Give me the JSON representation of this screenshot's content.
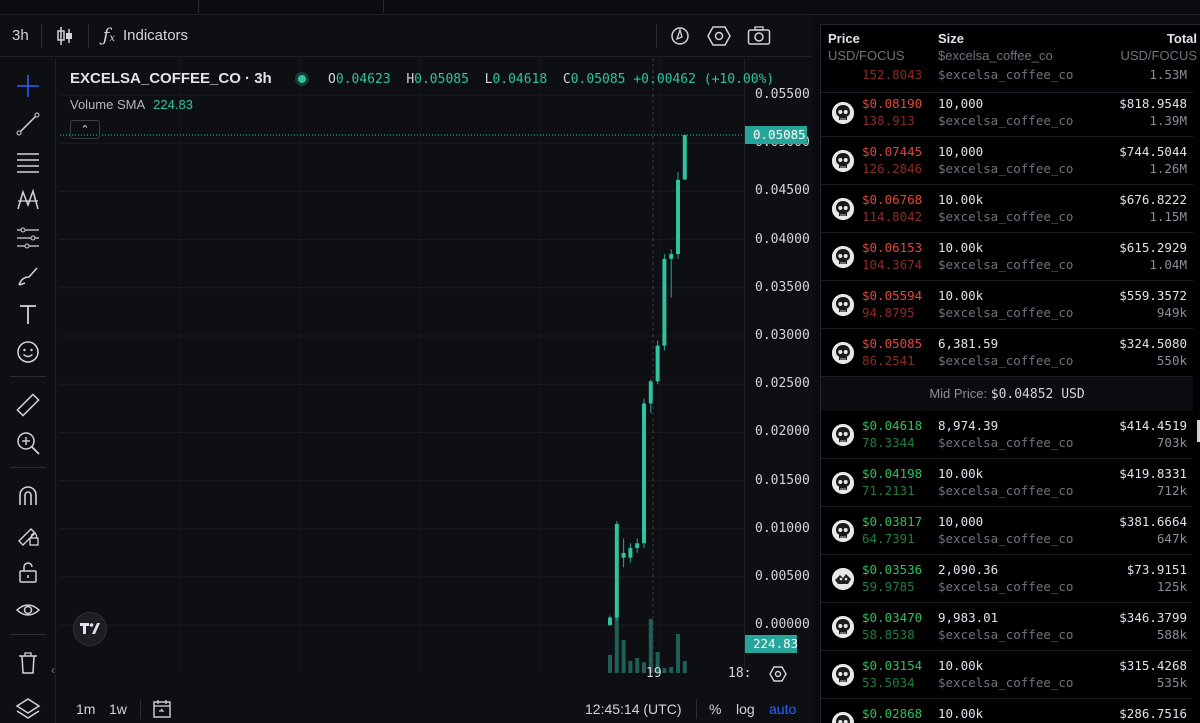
{
  "toolbar": {
    "interval": "3h",
    "indicators_label": "Indicators"
  },
  "legend": {
    "symbol": "EXCELSA_COFFEE_CO · 3h",
    "o_label": "O",
    "o": "0.04623",
    "h_label": "H",
    "h": "0.05085",
    "l_label": "L",
    "l": "0.04618",
    "c_label": "C",
    "c": "0.05085",
    "change": "+0.00462 (+10.00%)",
    "volume_label": "Volume SMA",
    "volume_value": "224.83"
  },
  "price_axis": {
    "ticks": [
      "0.05500",
      "0.05000",
      "0.04500",
      "0.04000",
      "0.03500",
      "0.03000",
      "0.02500",
      "0.02000",
      "0.01500",
      "0.01000",
      "0.00500",
      "0.00000"
    ],
    "last_price_badge": "0.05085",
    "volume_badge": "224.83"
  },
  "time_axis": {
    "labels": [
      "19",
      "18:"
    ]
  },
  "bottom_bar": {
    "range_1m": "1m",
    "range_1w": "1w",
    "clock": "12:45:14 (UTC)",
    "percent": "%",
    "log": "log",
    "auto": "auto"
  },
  "colors": {
    "up": "#26a69a",
    "up_bright": "#2ec4a0",
    "ask": "#e2453c",
    "bid": "#2fbf5e",
    "auto": "#2962ff"
  },
  "chart_data": {
    "type": "candlestick",
    "y_range": [
      -0.001,
      0.0565
    ],
    "candles": [
      {
        "o": 0.0,
        "h": 0.001,
        "l": 0.0,
        "c": 0.0008
      },
      {
        "o": 0.0008,
        "h": 0.0108,
        "l": 0.0005,
        "c": 0.0105
      },
      {
        "o": 0.0075,
        "h": 0.009,
        "l": 0.006,
        "c": 0.007
      },
      {
        "o": 0.007,
        "h": 0.0085,
        "l": 0.0065,
        "c": 0.008
      },
      {
        "o": 0.008,
        "h": 0.009,
        "l": 0.0075,
        "c": 0.0085
      },
      {
        "o": 0.0085,
        "h": 0.0235,
        "l": 0.008,
        "c": 0.023
      },
      {
        "o": 0.023,
        "h": 0.0255,
        "l": 0.022,
        "c": 0.0253
      },
      {
        "o": 0.0253,
        "h": 0.0295,
        "l": 0.025,
        "c": 0.029
      },
      {
        "o": 0.029,
        "h": 0.0385,
        "l": 0.0285,
        "c": 0.038
      },
      {
        "o": 0.038,
        "h": 0.039,
        "l": 0.034,
        "c": 0.0385
      },
      {
        "o": 0.0385,
        "h": 0.047,
        "l": 0.038,
        "c": 0.0462
      },
      {
        "o": 0.04623,
        "h": 0.05085,
        "l": 0.04618,
        "c": 0.05085
      }
    ],
    "volume": [
      0.3,
      1.0,
      0.55,
      0.2,
      0.25,
      0.18,
      0.9,
      0.35,
      0.08,
      0.1,
      0.65,
      0.2
    ]
  },
  "orderbook": {
    "headers": {
      "price": "Price",
      "price_sub": "USD/FOCUS",
      "size": "Size",
      "size_sub": "$excelsa_coffee_co",
      "total": "Total",
      "total_sub": "USD/FOCUS"
    },
    "partial_ask": {
      "price2": "152.8043",
      "size_sub": "$excelsa_coffee_co",
      "total_sub": "1.53M"
    },
    "asks": [
      {
        "price": "$0.08190",
        "price2": "138.913",
        "size": "10,000",
        "size_sub": "$excelsa_coffee_co",
        "total": "$818.9548",
        "total_sub": "1.39M"
      },
      {
        "price": "$0.07445",
        "price2": "126.2846",
        "size": "10,000",
        "size_sub": "$excelsa_coffee_co",
        "total": "$744.5044",
        "total_sub": "1.26M"
      },
      {
        "price": "$0.06768",
        "price2": "114.8042",
        "size": "10.00k",
        "size_sub": "$excelsa_coffee_co",
        "total": "$676.8222",
        "total_sub": "1.15M"
      },
      {
        "price": "$0.06153",
        "price2": "104.3674",
        "size": "10.00k",
        "size_sub": "$excelsa_coffee_co",
        "total": "$615.2929",
        "total_sub": "1.04M"
      },
      {
        "price": "$0.05594",
        "price2": "94.8795",
        "size": "10.00k",
        "size_sub": "$excelsa_coffee_co",
        "total": "$559.3572",
        "total_sub": "949k"
      },
      {
        "price": "$0.05085",
        "price2": "86.2541",
        "size": "6,381.59",
        "size_sub": "$excelsa_coffee_co",
        "total": "$324.5080",
        "total_sub": "550k"
      }
    ],
    "mid_label": "Mid Price:",
    "mid_value": "$0.04852 USD",
    "bids": [
      {
        "price": "$0.04618",
        "price2": "78.3344",
        "size": "8,974.39",
        "size_sub": "$excelsa_coffee_co",
        "total": "$414.4519",
        "total_sub": "703k"
      },
      {
        "price": "$0.04198",
        "price2": "71.2131",
        "size": "10.00k",
        "size_sub": "$excelsa_coffee_co",
        "total": "$419.8331",
        "total_sub": "712k"
      },
      {
        "price": "$0.03817",
        "price2": "64.7391",
        "size": "10,000",
        "size_sub": "$excelsa_coffee_co",
        "total": "$381.6664",
        "total_sub": "647k"
      },
      {
        "price": "$0.03536",
        "price2": "59.9785",
        "size": "2,090.36",
        "size_sub": "$excelsa_coffee_co",
        "total": "$73.9151",
        "total_sub": "125k"
      },
      {
        "price": "$0.03470",
        "price2": "58.8538",
        "size": "9,983.01",
        "size_sub": "$excelsa_coffee_co",
        "total": "$346.3799",
        "total_sub": "588k"
      },
      {
        "price": "$0.03154",
        "price2": "53.5034",
        "size": "10.00k",
        "size_sub": "$excelsa_coffee_co",
        "total": "$315.4268",
        "total_sub": "535k"
      },
      {
        "price": "$0.02868",
        "price2": "",
        "size": "10.00k",
        "size_sub": "",
        "total": "$286.7516",
        "total_sub": ""
      }
    ]
  }
}
